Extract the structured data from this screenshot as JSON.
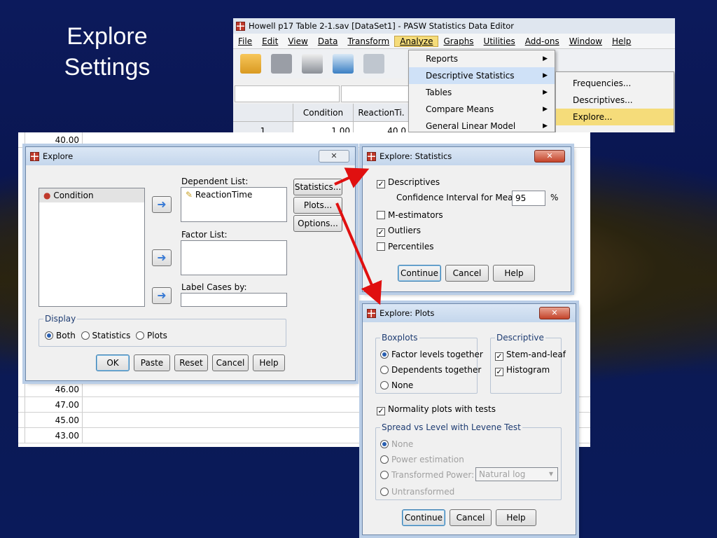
{
  "slide": {
    "title_line1": "Explore",
    "title_line2": "Settings"
  },
  "spss_window": {
    "title": "Howell p17 Table 2-1.sav [DataSet1] - PASW Statistics Data Editor",
    "menus": [
      "File",
      "Edit",
      "View",
      "Data",
      "Transform",
      "Analyze",
      "Graphs",
      "Utilities",
      "Add-ons",
      "Window",
      "Help"
    ],
    "active_menu": "Analyze",
    "grid_headers": [
      "Condition",
      "ReactionTi."
    ],
    "first_row": {
      "num": "1",
      "condition": "1.00",
      "reaction": "40.0"
    }
  },
  "analyze_menu": {
    "items": [
      "Reports",
      "Descriptive Statistics",
      "Tables",
      "Compare Means",
      "General Linear Model"
    ],
    "highlighted": "Descriptive Statistics"
  },
  "descriptive_submenu": {
    "items": [
      "Frequencies...",
      "Descriptives...",
      "Explore..."
    ],
    "highlighted": "Explore..."
  },
  "sheet_rows": [
    "40.00",
    "46.00",
    "47.00",
    "45.00",
    "43.00"
  ],
  "explore_dialog": {
    "title": "Explore",
    "variable_list": [
      "Condition"
    ],
    "dependent_label": "Dependent List:",
    "dependent_items": [
      "ReactionTime"
    ],
    "factor_label": "Factor List:",
    "label_cases_label": "Label Cases by:",
    "side_buttons": [
      "Statistics...",
      "Plots...",
      "Options..."
    ],
    "display_group": "Display",
    "display_options": [
      "Both",
      "Statistics",
      "Plots"
    ],
    "display_selected": "Both",
    "bottom_buttons": [
      "OK",
      "Paste",
      "Reset",
      "Cancel",
      "Help"
    ]
  },
  "stats_dialog": {
    "title": "Explore: Statistics",
    "descriptives": "Descriptives",
    "ci_label": "Confidence Interval for Mean:",
    "ci_value": "95",
    "ci_unit": "%",
    "m_estimators": "M-estimators",
    "outliers": "Outliers",
    "percentiles": "Percentiles",
    "checked": {
      "descriptives": true,
      "m_estimators": false,
      "outliers": true,
      "percentiles": false
    },
    "buttons": [
      "Continue",
      "Cancel",
      "Help"
    ]
  },
  "plots_dialog": {
    "title": "Explore: Plots",
    "boxplots_group": "Boxplots",
    "boxplot_options": [
      "Factor levels together",
      "Dependents together",
      "None"
    ],
    "boxplot_selected": "Factor levels together",
    "descriptive_group": "Descriptive",
    "descriptive_options": [
      "Stem-and-leaf",
      "Histogram"
    ],
    "normality": "Normality plots with tests",
    "spread_group": "Spread vs Level with Levene Test",
    "spread_options": [
      "None",
      "Power estimation",
      "Transformed",
      "Untransformed"
    ],
    "power_label": "Power:",
    "power_value": "Natural log",
    "buttons": [
      "Continue",
      "Cancel",
      "Help"
    ]
  },
  "colors": {
    "arrow": "#e01010",
    "menu_highlight": "#f5dc7a",
    "background_top": "#0c1a5c"
  }
}
